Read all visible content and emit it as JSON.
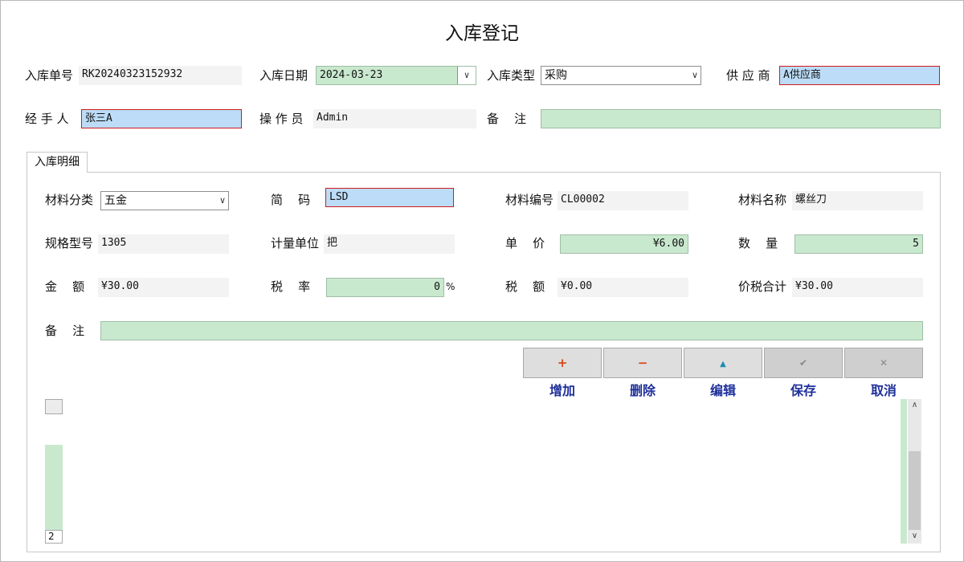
{
  "title": "入库登记",
  "header": {
    "order_no_label": "入库单号",
    "order_no": "RK20240323152932",
    "date_label": "入库日期",
    "date": "2024-03-23",
    "type_label": "入库类型",
    "type": "采购",
    "supplier_label": "供 应 商",
    "supplier": "A供应商",
    "handler_label": "经 手 人",
    "handler": "张三A",
    "operator_label": "操 作 员",
    "operator": "Admin",
    "remark_label": "备    注",
    "remark": ""
  },
  "tab": {
    "label": "入库明细"
  },
  "detail": {
    "category_label": "材料分类",
    "category": "五金",
    "code_label": "简    码",
    "code": "LSD",
    "material_no_label": "材料编号",
    "material_no": "CL00002",
    "material_name_label": "材料名称",
    "material_name": "螺丝刀",
    "spec_label": "规格型号",
    "spec": "1305",
    "unit_label": "计量单位",
    "unit": "把",
    "price_label": "单    价",
    "price": "¥6.00",
    "qty_label": "数    量",
    "qty": "5",
    "amount_label": "金    额",
    "amount": "¥30.00",
    "tax_rate_label": "税    率",
    "tax_rate": "0",
    "percent": "%",
    "tax_label": "税    额",
    "tax": "¥0.00",
    "total_label": "价税合计",
    "total": "¥30.00",
    "remark_label": "备    注",
    "remark": ""
  },
  "toolbar": {
    "add_label": "增加",
    "delete_label": "删除",
    "edit_label": "编辑",
    "save_label": "保存",
    "cancel_label": "取消",
    "add_glyph": "+",
    "delete_glyph": "−",
    "edit_glyph": "▲",
    "save_glyph": "✔",
    "cancel_glyph": "✕"
  },
  "grid": {
    "row_number": "2"
  },
  "icons": {
    "dropdown": "chevron-down-icon",
    "scroll_up": "scroll-up-icon",
    "scroll_down": "scroll-down-icon"
  },
  "colors": {
    "editable": "#c9e9cf",
    "focus": "#bcdcf7",
    "required_border": "#d11b1b",
    "action_text": "#1e2f9a"
  }
}
